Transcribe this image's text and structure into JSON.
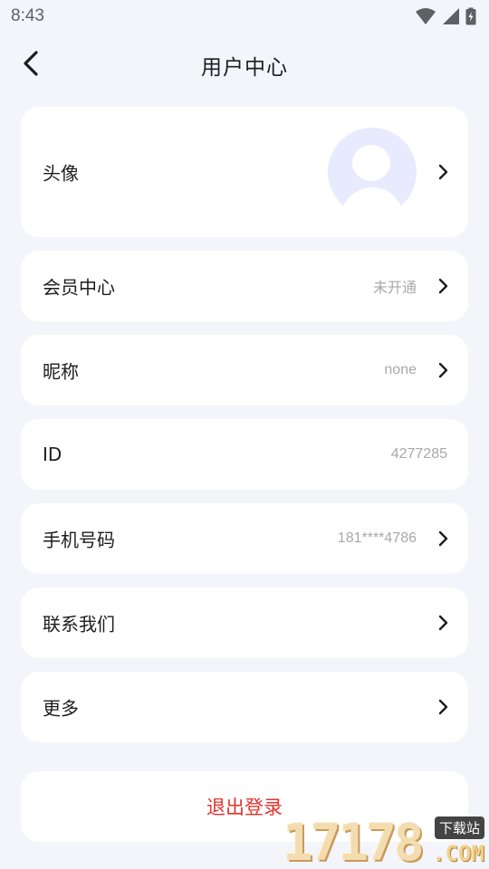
{
  "status_bar": {
    "time": "8:43",
    "icons": [
      "wifi-icon",
      "cellular-signal-icon",
      "battery-charging-icon"
    ]
  },
  "header": {
    "back_icon": "chevron-left-icon",
    "title": "用户中心"
  },
  "avatar_row": {
    "label": "头像",
    "avatar_icon": "default-user-avatar",
    "avatar_bg_color": "#e8ebfd"
  },
  "rows": {
    "membership": {
      "label": "会员中心",
      "value": "未开通"
    },
    "nickname": {
      "label": "昵称",
      "value": "none"
    },
    "id": {
      "label": "ID",
      "value": "4277285"
    },
    "phone": {
      "label": "手机号码",
      "value": "181****4786"
    },
    "contact": {
      "label": "联系我们"
    },
    "more": {
      "label": "更多"
    }
  },
  "logout": {
    "label": "退出登录",
    "color": "#e5322e"
  },
  "watermark": {
    "number": "17178",
    "badge": "下载站",
    "suffix": ".COM"
  },
  "colors": {
    "page_background": "#f4f5fa",
    "card_background": "#ffffff",
    "secondary_text": "#a8a8ad"
  }
}
